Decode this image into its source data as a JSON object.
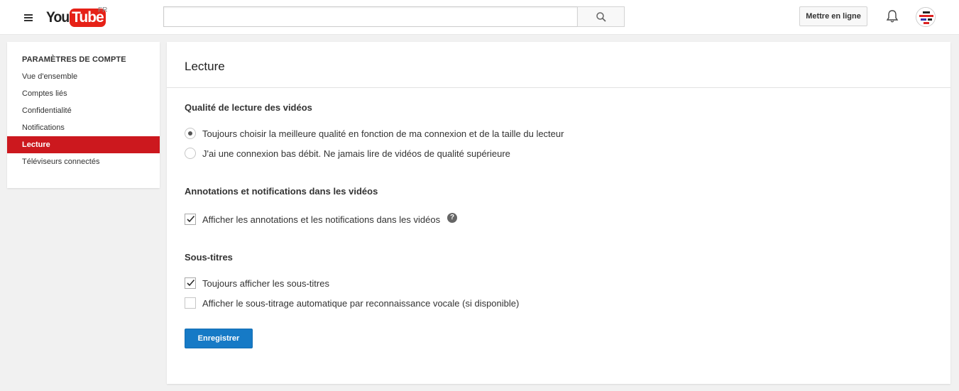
{
  "header": {
    "logo_you": "You",
    "logo_tube": "Tube",
    "logo_country": "FR",
    "search_value": "",
    "search_placeholder": "",
    "upload_label": "Mettre en ligne"
  },
  "sidebar": {
    "heading": "PARAMÈTRES DE COMPTE",
    "items": [
      {
        "label": "Vue d'ensemble",
        "active": false
      },
      {
        "label": "Comptes liés",
        "active": false
      },
      {
        "label": "Confidentialité",
        "active": false
      },
      {
        "label": "Notifications",
        "active": false
      },
      {
        "label": "Lecture",
        "active": true
      },
      {
        "label": "Téléviseurs connectés",
        "active": false
      }
    ]
  },
  "main": {
    "title": "Lecture",
    "quality": {
      "title": "Qualité de lecture des vidéos",
      "options": [
        {
          "label": "Toujours choisir la meilleure qualité en fonction de ma connexion et de la taille du lecteur",
          "checked": true
        },
        {
          "label": "J'ai une connexion bas débit. Ne jamais lire de vidéos de qualité supérieure",
          "checked": false
        }
      ]
    },
    "annotations": {
      "title": "Annotations et notifications dans les vidéos",
      "option": {
        "label": "Afficher les annotations et les notifications dans les vidéos",
        "checked": true
      },
      "help": "?"
    },
    "subtitles": {
      "title": "Sous-titres",
      "options": [
        {
          "label": "Toujours afficher les sous-titres",
          "checked": true
        },
        {
          "label": "Afficher le sous-titrage automatique par reconnaissance vocale (si disponible)",
          "checked": false
        }
      ]
    },
    "save_label": "Enregistrer"
  },
  "colors": {
    "brand_red": "#e62117",
    "active_nav": "#cc181e",
    "primary_button": "#167ac6"
  },
  "icons": [
    "menu-icon",
    "search-icon",
    "bell-icon",
    "checkmark-icon",
    "help-icon"
  ]
}
